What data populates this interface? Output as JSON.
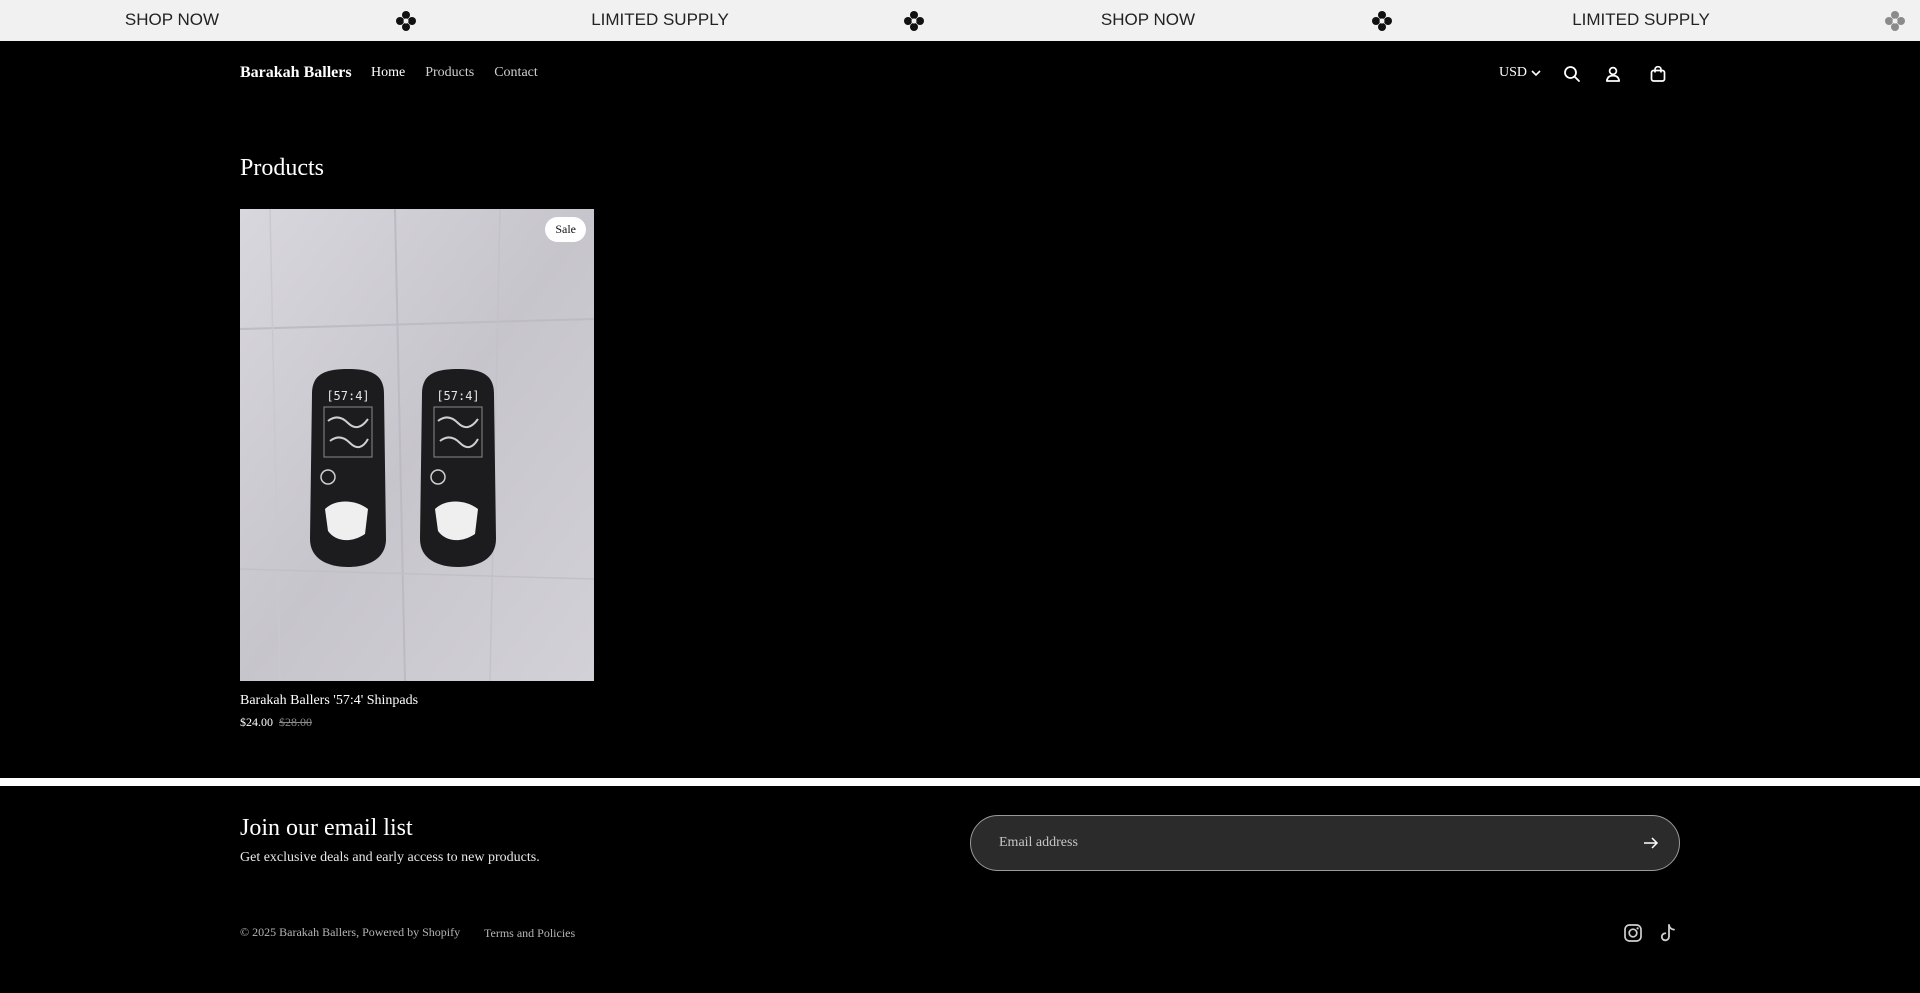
{
  "announcement": {
    "items": [
      "SHOP NOW",
      "LIMITED SUPPLY",
      "SHOP NOW",
      "LIMITED SUPPLY"
    ],
    "separator_icon": "clover-diamond-icon"
  },
  "header": {
    "brand": "Barakah Ballers",
    "nav": [
      {
        "label": "Home",
        "active": true
      },
      {
        "label": "Products",
        "active": false
      },
      {
        "label": "Contact",
        "active": false
      }
    ],
    "currency": "USD",
    "icons": [
      "search-icon",
      "account-icon",
      "cart-icon"
    ]
  },
  "main": {
    "title": "Products",
    "products": [
      {
        "title": "Barakah Ballers '57:4' Shinpads",
        "badge": "Sale",
        "price": "$24.00",
        "compare_price": "$28.00",
        "image_text": [
          "[57:4]",
          "[57:4]"
        ]
      }
    ]
  },
  "footer": {
    "newsletter_title": "Join our email list",
    "newsletter_subtitle": "Get exclusive deals and early access to new products.",
    "email_placeholder": "Email address",
    "copyright": "© 2025 Barakah Ballers, Powered by Shopify",
    "terms": "Terms and Policies",
    "social": [
      "instagram-icon",
      "tiktok-icon"
    ]
  },
  "colors": {
    "background": "#000000",
    "announcement_bg": "#f1f1f1",
    "accent": "#ffffff"
  }
}
